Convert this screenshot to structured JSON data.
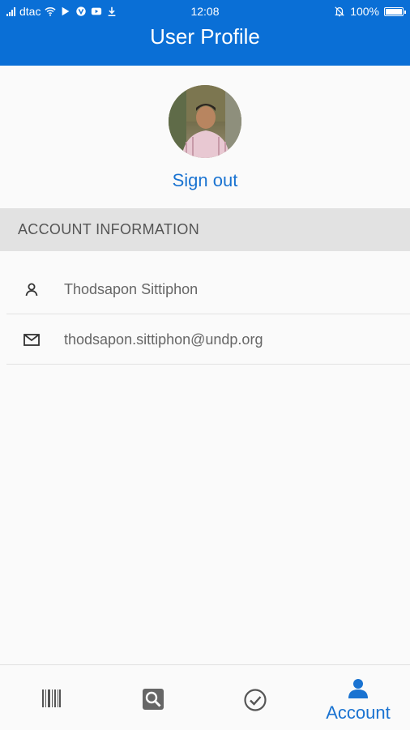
{
  "status_bar": {
    "carrier": "dtac",
    "time": "12:08",
    "battery": "100%"
  },
  "header": {
    "title": "User Profile"
  },
  "profile": {
    "sign_out_label": "Sign out"
  },
  "account_section": {
    "heading": "ACCOUNT INFORMATION",
    "name": "Thodsapon Sittiphon",
    "email": "thodsapon.sittiphon@undp.org"
  },
  "bottom_nav": {
    "tabs": [
      {
        "icon": "barcode-icon",
        "label": ""
      },
      {
        "icon": "search-icon",
        "label": ""
      },
      {
        "icon": "check-circle-icon",
        "label": ""
      },
      {
        "icon": "person-icon",
        "label": "Account",
        "active": true
      }
    ],
    "active_color": "#1a73d1"
  },
  "colors": {
    "header_bg": "#0a6fd6",
    "accent": "#1a73d1",
    "section_bg": "#e2e2e2"
  }
}
